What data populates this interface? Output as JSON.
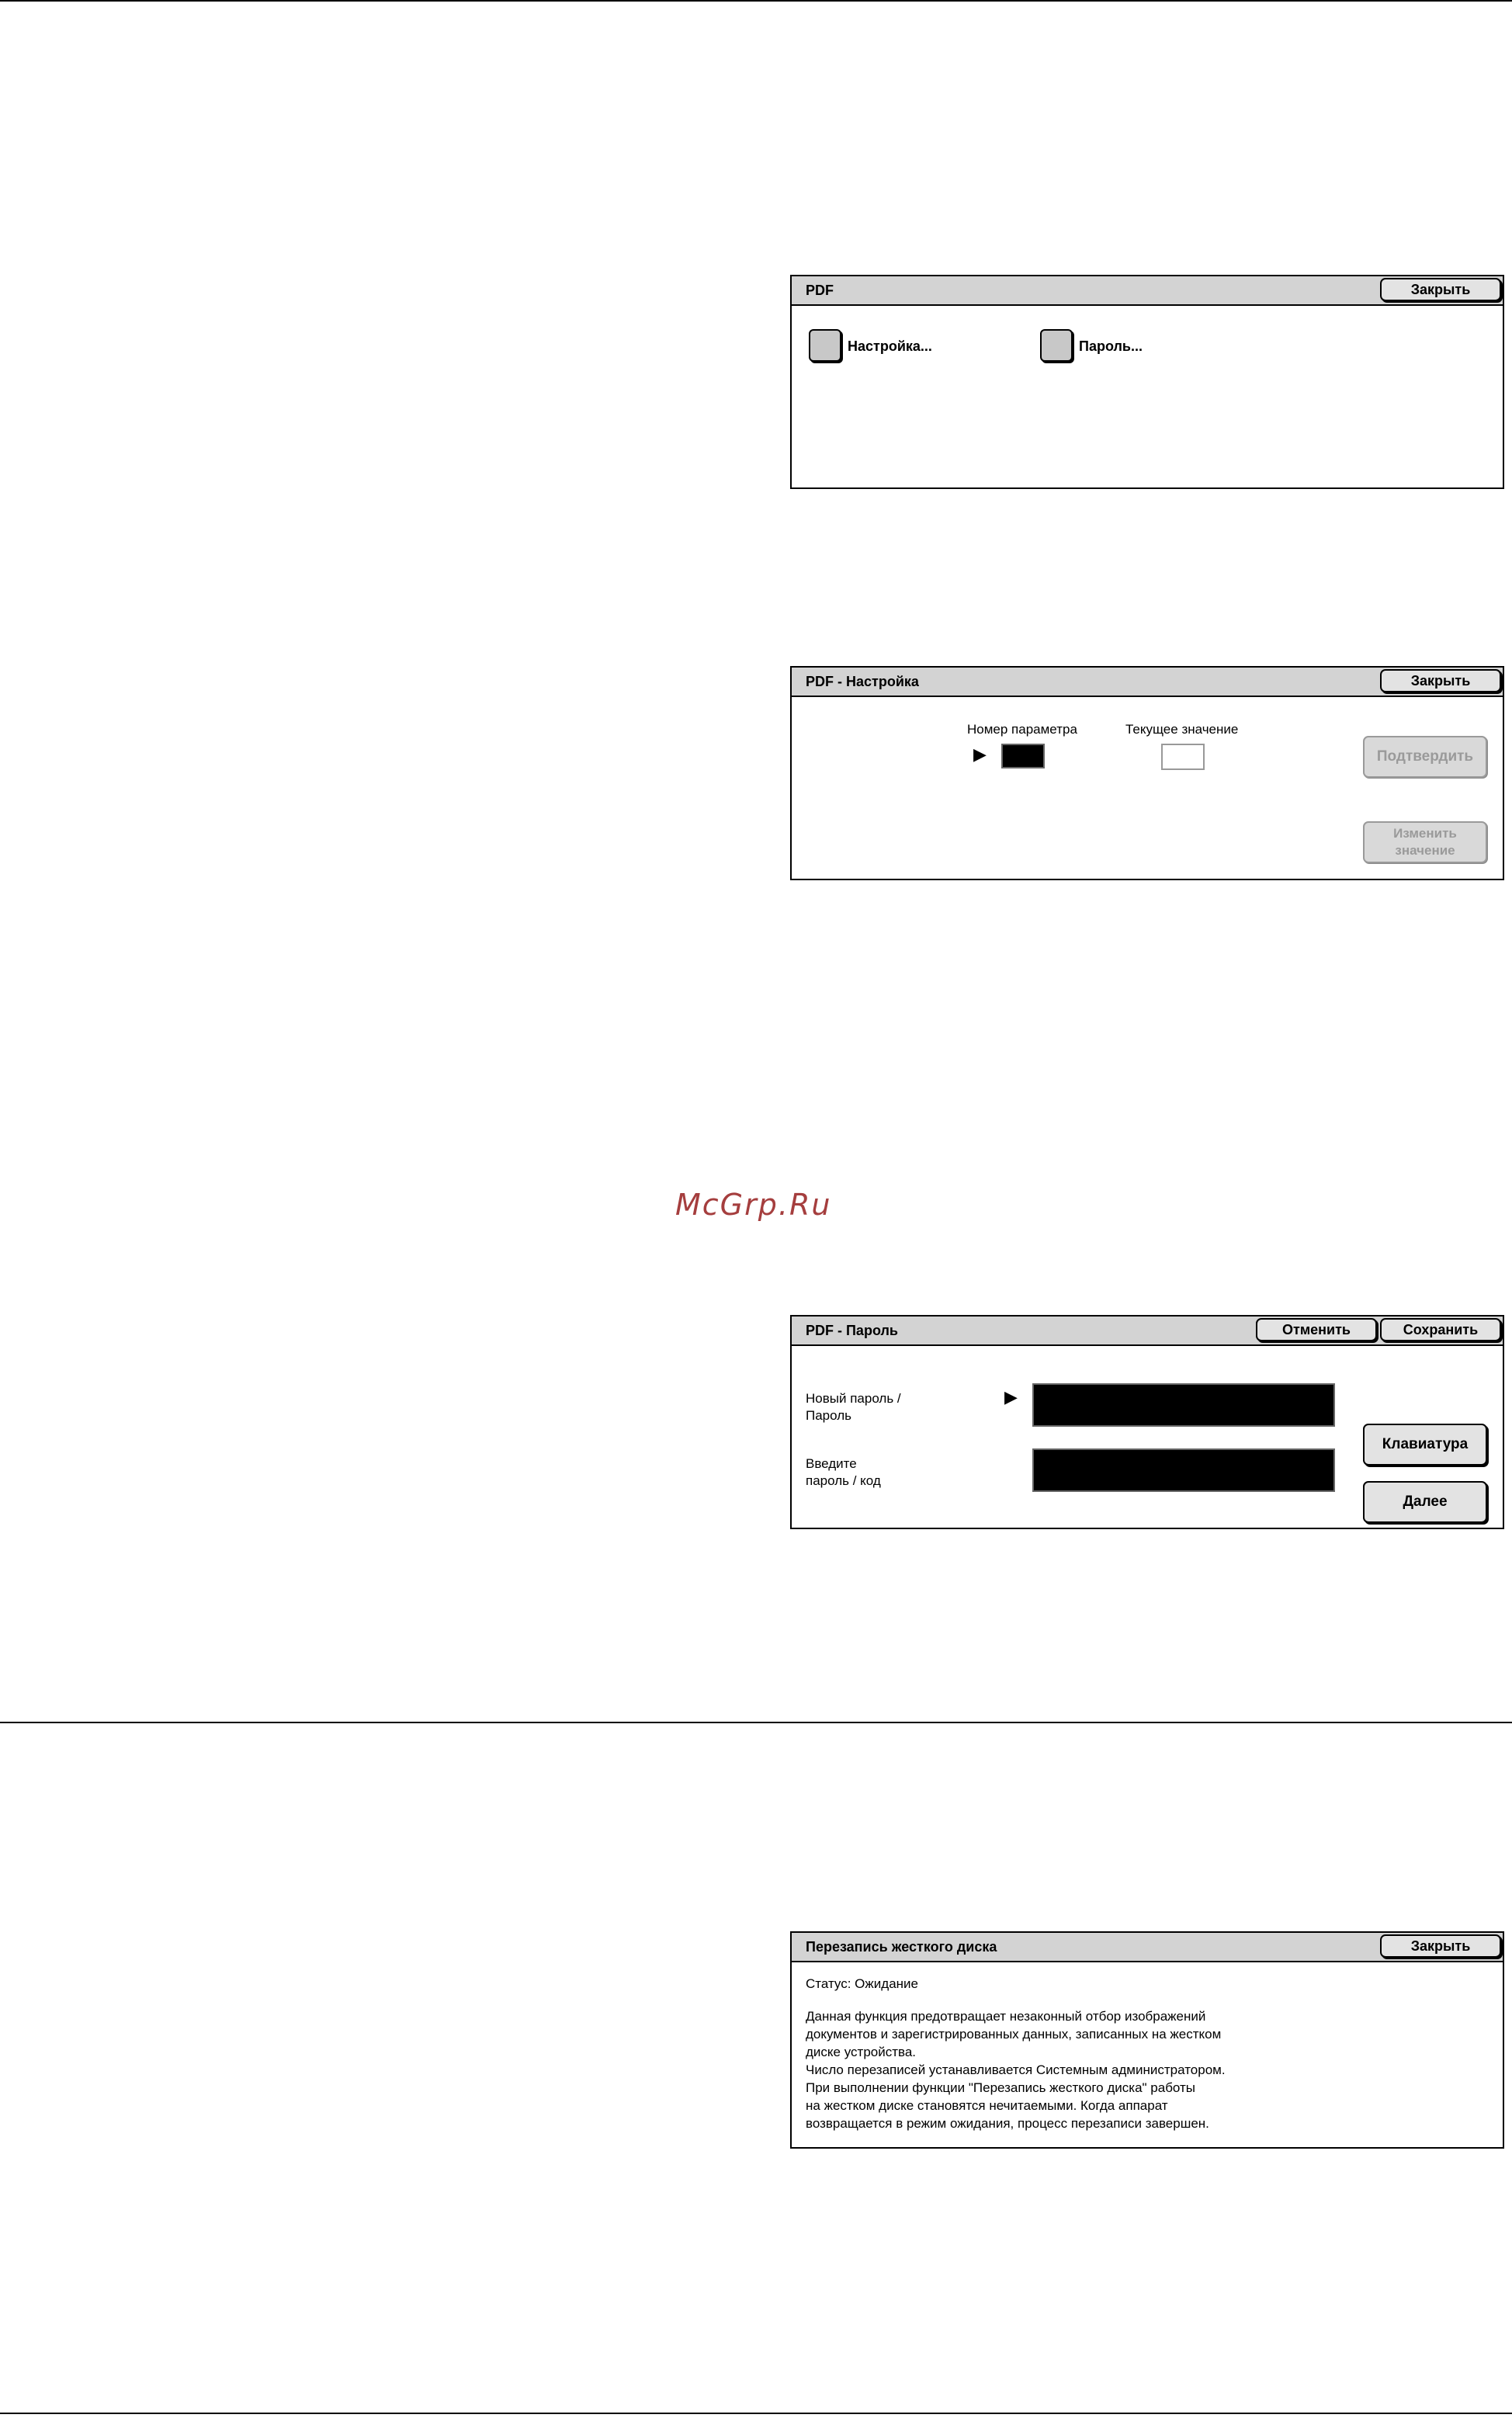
{
  "watermark": "McGrp.Ru",
  "pdf_panel": {
    "title": "PDF",
    "close_label": "Закрыть",
    "settings_label": "Настройка...",
    "password_label": "Пароль..."
  },
  "pdf_settings_panel": {
    "title": "PDF - Настройка",
    "close_label": "Закрыть",
    "param_number_label": "Номер параметра",
    "current_value_label": "Текущее значение",
    "arrow": "▶",
    "confirm_label": "Подтвердить",
    "change_label": "Изменить значение"
  },
  "pdf_password_panel": {
    "title": "PDF - Пароль",
    "cancel_label": "Отменить",
    "save_label": "Сохранить",
    "new_password_line1": "Новый пароль /",
    "new_password_line2": "Пароль",
    "enter_password_line1": "Введите",
    "enter_password_line2": "пароль / код",
    "arrow": "▶",
    "keyboard_label": "Клавиатура",
    "next_label": "Далее"
  },
  "disk_overwrite_panel": {
    "title": "Перезапись жесткого диска",
    "close_label": "Закрыть",
    "status": "Статус: Ожидание",
    "lines": [
      "Данная функция предотвращает незаконный отбор изображений",
      "документов и зарегистрированных данных, записанных на жестком",
      "диске устройства.",
      "Число перезаписей устанавливается Системным администратором.",
      "При выполнении функции \"Перезапись жесткого диска\" работы",
      "на жестком диске становятся нечитаемыми. Когда аппарат",
      "возвращается в режим ожидания, процесс перезаписи завершен."
    ]
  }
}
